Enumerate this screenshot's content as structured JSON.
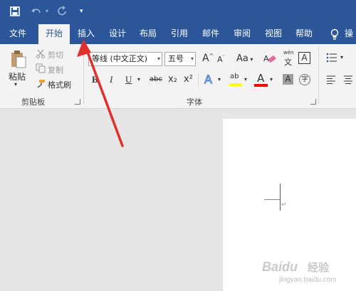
{
  "qat": {
    "save_icon": "save-icon",
    "undo_icon": "undo-icon",
    "redo_icon": "redo-icon",
    "customize_icon": "customize-qat-icon"
  },
  "tabs": [
    "文件",
    "开始",
    "插入",
    "设计",
    "布局",
    "引用",
    "邮件",
    "审阅",
    "视图",
    "帮助",
    "操"
  ],
  "active_tab": "开始",
  "clipboard": {
    "paste": "粘贴",
    "cut": "剪切",
    "copy": "复制",
    "format_painter": "格式刷",
    "group_label": "剪贴板"
  },
  "font": {
    "font_name": "等线 (中文正文)",
    "font_size": "五号",
    "grow": "A",
    "shrink": "A",
    "change_case": "Aa",
    "pinyin_top": "wén",
    "pinyin_bottom": "文",
    "char_border": "A",
    "bold": "B",
    "italic": "I",
    "underline": "U",
    "strike": "abc",
    "subscript": "x₂",
    "superscript": "x²",
    "text_effects": "A",
    "highlight": "ab",
    "font_color": "A",
    "char_shading": "A",
    "enclose": "字",
    "group_label": "字体"
  },
  "colors": {
    "ribbon_blue": "#2b579a",
    "highlight_yellow": "#ffff00",
    "font_red": "#ff0000",
    "arrow_red": "#e0302a"
  },
  "watermark": {
    "brand": "Baidu",
    "cn": "经验",
    "url": "jingyan.baidu.com"
  }
}
